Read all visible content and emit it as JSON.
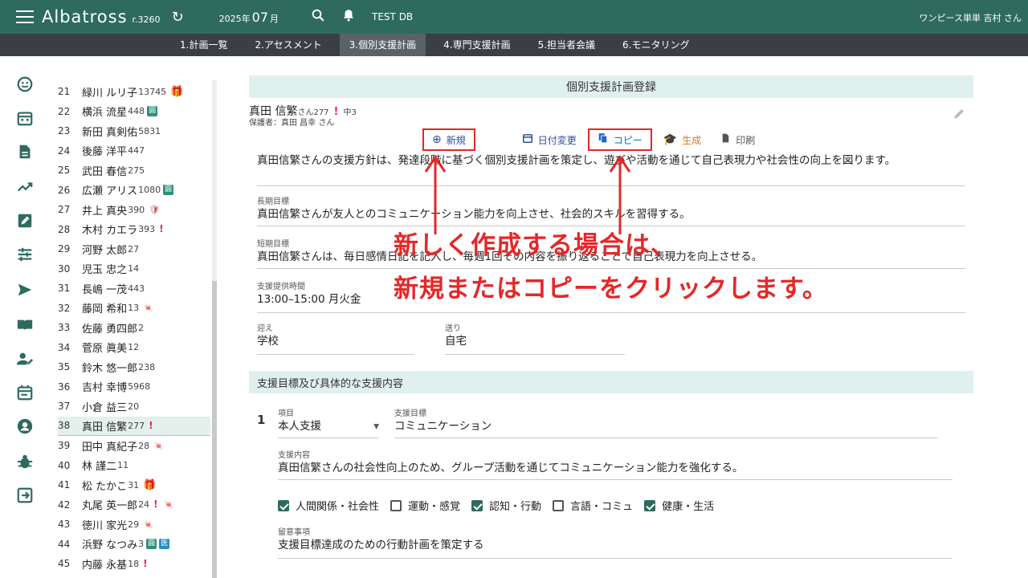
{
  "header": {
    "app_name": "Albatross",
    "version": "r.3260",
    "year": "2025年",
    "month": "07",
    "month_unit": "月",
    "db_label": "TEST DB",
    "user": "ワンピース単単 吉村 さん"
  },
  "tabs": [
    {
      "label": "1.計画一覧"
    },
    {
      "label": "2.アセスメント"
    },
    {
      "label": "3.個別支援計画",
      "active": true
    },
    {
      "label": "4.専門支援計画"
    },
    {
      "label": "5.担当者会議"
    },
    {
      "label": "6.モニタリング"
    }
  ],
  "rail_icons": [
    "smile-icon",
    "calendar-icon",
    "document-icon",
    "trend-icon",
    "edit-icon",
    "tune-icon",
    "send-icon",
    "book-icon",
    "user-edit-icon",
    "event-icon",
    "account-icon",
    "bug-icon",
    "logout-icon"
  ],
  "clients": [
    {
      "num": "21",
      "name": "緑川 ルリ子",
      "sub": "13745",
      "badges": [
        "gift"
      ]
    },
    {
      "num": "22",
      "name": "横浜 流星",
      "sub": "448",
      "badges": [
        "green"
      ]
    },
    {
      "num": "23",
      "name": "新田 真剣佑",
      "sub": "5831",
      "badges": []
    },
    {
      "num": "24",
      "name": "後藤 洋平",
      "sub": "447",
      "badges": []
    },
    {
      "num": "25",
      "name": "武田 春信",
      "sub": "275",
      "badges": []
    },
    {
      "num": "26",
      "name": "広瀬 アリス",
      "sub": "1080",
      "badges": [
        "green"
      ]
    },
    {
      "num": "27",
      "name": "井上 真央",
      "sub": "390",
      "badges": [
        "shield"
      ]
    },
    {
      "num": "28",
      "name": "木村 カエラ",
      "sub": "393",
      "badges": [
        "excl"
      ]
    },
    {
      "num": "29",
      "name": "河野 太郎",
      "sub": "27",
      "badges": []
    },
    {
      "num": "30",
      "name": "児玉 忠之",
      "sub": "14",
      "badges": []
    },
    {
      "num": "31",
      "name": "長嶋 一茂",
      "sub": "443",
      "badges": []
    },
    {
      "num": "32",
      "name": "藤岡 希和",
      "sub": "13",
      "badges": [
        "candy"
      ]
    },
    {
      "num": "33",
      "name": "佐藤 勇四郎",
      "sub": "2",
      "badges": []
    },
    {
      "num": "34",
      "name": "菅原 眞美",
      "sub": "12",
      "badges": []
    },
    {
      "num": "35",
      "name": "鈴木 悠一郎",
      "sub": "238",
      "badges": []
    },
    {
      "num": "36",
      "name": "吉村 幸博",
      "sub": "5968",
      "badges": []
    },
    {
      "num": "37",
      "name": "小倉 益三",
      "sub": "20",
      "badges": []
    },
    {
      "num": "38",
      "name": "真田 信繁",
      "sub": "277",
      "badges": [
        "excl"
      ],
      "selected": true
    },
    {
      "num": "39",
      "name": "田中 真紀子",
      "sub": "28",
      "badges": [
        "candy"
      ]
    },
    {
      "num": "40",
      "name": "林 謹二",
      "sub": "11",
      "badges": []
    },
    {
      "num": "41",
      "name": "松 たかこ",
      "sub": "31",
      "badges": [
        "gift"
      ]
    },
    {
      "num": "42",
      "name": "丸尾 英一郎",
      "sub": "24",
      "badges": [
        "excl",
        "candy"
      ]
    },
    {
      "num": "43",
      "name": "徳川 家光",
      "sub": "29",
      "badges": [
        "candy"
      ]
    },
    {
      "num": "44",
      "name": "浜野 なつみ",
      "sub": "3",
      "badges": [
        "green",
        "blue"
      ]
    },
    {
      "num": "45",
      "name": "内藤 永基",
      "sub": "18",
      "badges": [
        "excl"
      ]
    }
  ],
  "badge_text": {
    "green": "圓",
    "blue": "医",
    "excl": "!",
    "gift": "🎁",
    "candy": "🍬",
    "shield": "🛡"
  },
  "form": {
    "title": "個別支援計画登録",
    "person_name": "真田 信繁",
    "person_suffix": "さん277",
    "person_flag": "!",
    "person_grade": "中3",
    "guardian": "保護者：真田 昌幸 さん",
    "actions": {
      "new": "新規",
      "date_change": "日付変更",
      "copy": "コピー",
      "generate": "生成",
      "print": "印刷"
    },
    "policy": "真田信繁さんの支援方針は、発達段階に基づく個別支援計画を策定し、遊びや活動を通じて自己表現力や社会性の向上を図ります。",
    "long_goal_label": "長期目標",
    "long_goal": "真田信繁さんが友人とのコミュニケーション能力を向上させ、社会的スキルを習得する。",
    "short_goal_label": "短期目標",
    "short_goal": "真田信繁さんは、毎日感情日記を記入し、毎週1回その内容を振り返ることで自己表現力を向上させる。",
    "time_label": "支援提供時間",
    "time": "13:00–15:00 月火金",
    "pickup_label": "迎え",
    "pickup": "学校",
    "dropoff_label": "送り",
    "dropoff": "自宅",
    "section2_title": "支援目標及び具体的な支援内容",
    "row_num": "1",
    "item_label": "項目",
    "item": "本人支援",
    "target_label": "支援目標",
    "target": "コミュニケーション",
    "content_label": "支援内容",
    "content": "真田信繁さんの社会性向上のため、グループ活動を通じてコミュニケーション能力を強化する。",
    "checks": [
      {
        "label": "人間関係・社会性",
        "checked": true
      },
      {
        "label": "運動・感覚",
        "checked": false
      },
      {
        "label": "認知・行動",
        "checked": true
      },
      {
        "label": "言語・コミュ",
        "checked": false
      },
      {
        "label": "健康・生活",
        "checked": true
      }
    ],
    "notes_label": "留意事項",
    "notes": "支援目標達成のための行動計画を策定する"
  },
  "annotation": {
    "line1": "新しく作成する場合は、",
    "line2": "新規またはコピーをクリックします。"
  },
  "colors": {
    "brand": "#2e6b5e",
    "annotation": "#e52727",
    "section": "#e0f0ee"
  }
}
